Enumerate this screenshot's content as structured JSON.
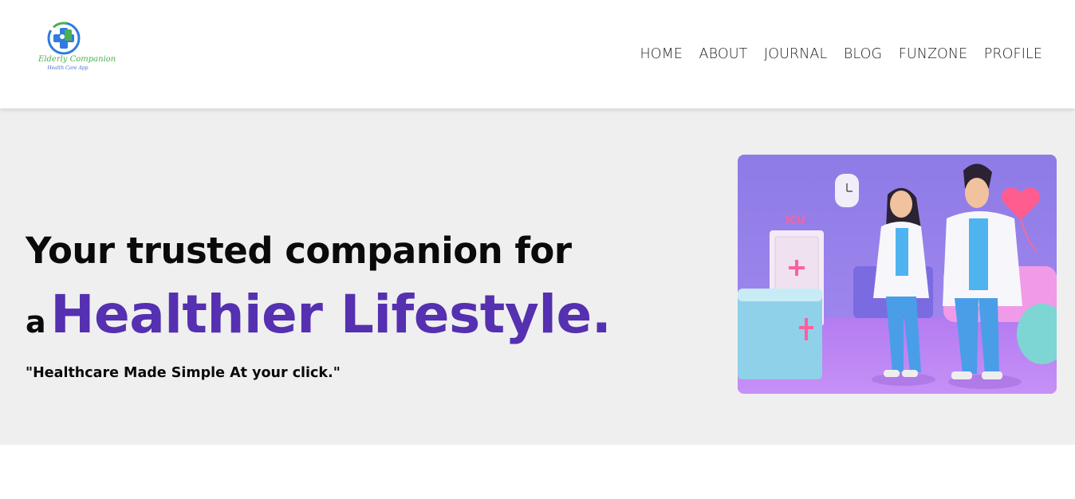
{
  "brand": {
    "name": "Elderly Companion",
    "tagline": "Health Care App",
    "colors": {
      "green": "#4caf50",
      "blue": "#2f7be0"
    }
  },
  "nav": {
    "items": [
      {
        "label": "HOME",
        "name": "nav-home"
      },
      {
        "label": "ABOUT",
        "name": "nav-about"
      },
      {
        "label": "JOURNAL",
        "name": "nav-journal"
      },
      {
        "label": "BLOG",
        "name": "nav-blog"
      },
      {
        "label": "FUNZONE",
        "name": "nav-funzone"
      },
      {
        "label": "PROFILE",
        "name": "nav-profile"
      }
    ]
  },
  "hero": {
    "headline": "Your trusted companion for",
    "line2_prefix": "a",
    "line2_accent": "Healthier Lifestyle.",
    "tagline": "\"Healthcare Made Simple At your click.\"",
    "accent_color": "#5530b0",
    "background_color": "#efefef",
    "image": {
      "icon": "doctors-illustration",
      "sign_text": "ICU"
    }
  }
}
